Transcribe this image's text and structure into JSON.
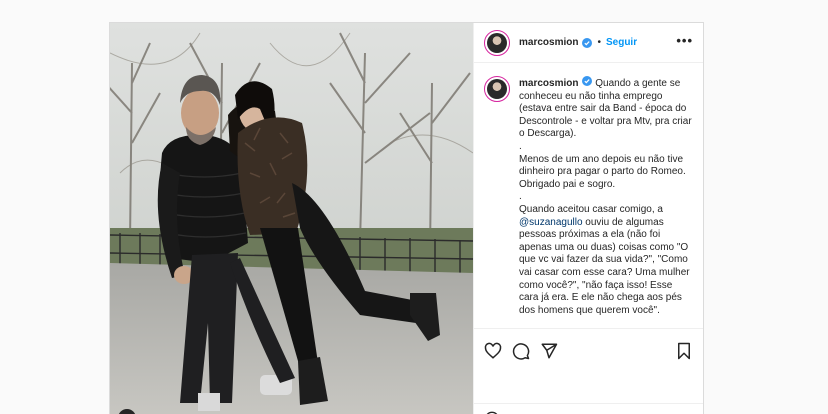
{
  "post": {
    "header": {
      "username": "marcosmion",
      "separator": "•",
      "follow_label": "Seguir",
      "more_label": "•••"
    },
    "caption": {
      "username": "marcosmion",
      "line1": " Quando a gente se conheceu eu não tinha emprego (estava entre sair da Band - época do Descontrole - e voltar pra Mtv, pra criar o Descarga).",
      "dot1": ".",
      "line2": "Menos de um ano depois eu não tive dinheiro pra pagar o parto do Romeo. Obrigado pai e sogro.",
      "dot2": ".",
      "line3_pre": "Quando aceitou casar comigo, a ",
      "mention": "@suzanagullo",
      "line3_post": " ouviu de algumas pessoas próximas a ela (não foi apenas uma ou duas) coisas como \"O que vc vai fazer da sua vida?\", \"Como vai casar com esse cara? Uma mulher como você?\", \"não faça isso! Esse cara já era. E ele não chega aos pés dos homens que querem você\"."
    },
    "actions": {
      "like_icon": "heart-icon",
      "comment_icon": "comment-icon",
      "share_icon": "share-icon",
      "save_icon": "bookmark-icon"
    },
    "colors": {
      "link": "#0095f6",
      "verified": "#3897f0",
      "mention": "#00376b"
    }
  }
}
